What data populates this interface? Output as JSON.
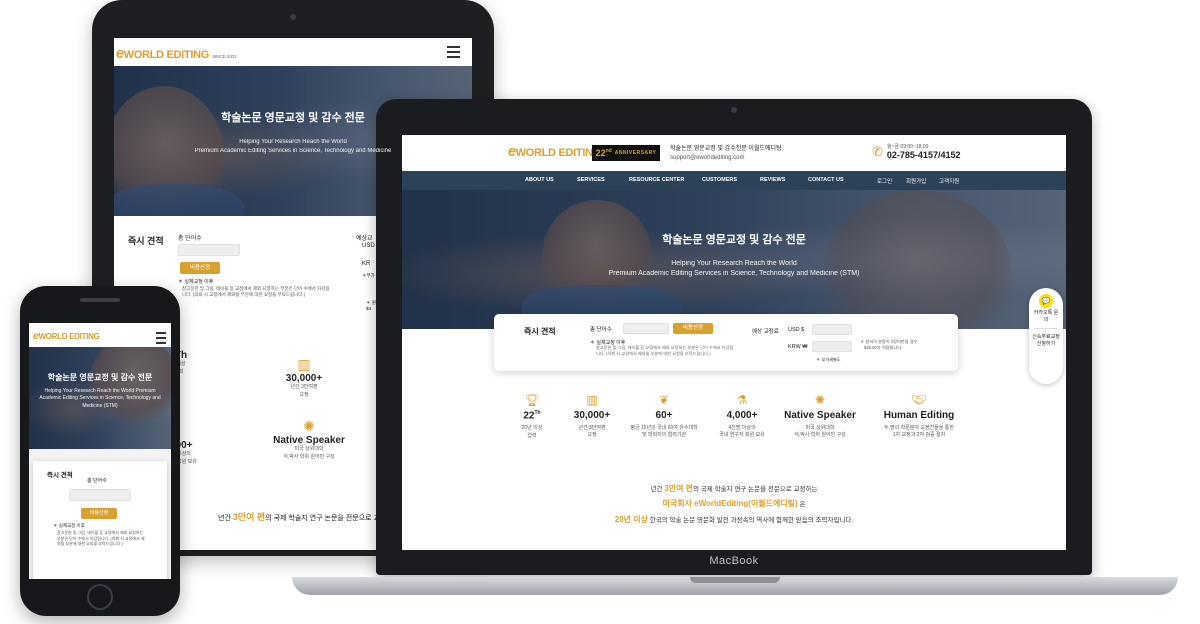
{
  "site": {
    "logo_main": "WORLD EDITING",
    "logo_e": "e",
    "logo_since": "SINCE 2001",
    "anniversary": "22",
    "anniversary_suffix": "nd",
    "anniversary_word": "ANNIVERSARY",
    "tagline": "학술논문 영문교정 및 감수전문 이월드에디팅",
    "email": "support@eworldediting.com",
    "hours": "월~금 09:00~18:00",
    "phone": "02-785-4157/4152"
  },
  "nav": {
    "items": [
      "ABOUT US",
      "SERVICES",
      "RESOURCE CENTER",
      "CUSTOMERS",
      "REVIEWS",
      "CONTACT US"
    ],
    "util": [
      "로그인",
      "회원가입",
      "고객지원"
    ]
  },
  "hero": {
    "title": "학술논문 영문교정 및 감수 전문",
    "line1": "Helping Your Research Reach the World",
    "line2": "Premium Academic Editing Services in Science, Technology and Medicine (STM)",
    "tablet_line2": "Premium Academic Editing Services in Science, Technology and Medicine",
    "phone_sub": "Helping Your Research Reach the World Premium Academic Editing Services in Science, Technology and Medicine (STM)"
  },
  "quote": {
    "title": "즉시 견적",
    "word_count_label": "총 단어수",
    "button": "비용산정",
    "price_label": "예상 교정료",
    "usd": "USD $",
    "krw": "KRW ₩",
    "vat": "＊ 부가세별도",
    "notice_title": "＊ 실제교정 이후",
    "notice_body": "참고문헌 및 그림, 테이블 등 교정에서 제외 요청하는 부분은 단어 수에서 차감됩니다. (의뢰 시 교정에서 제외될 부분에 대한 요청을 부탁드립니다.)",
    "side_note_1": "＊ 원서의 분량이 3장미만일 경우",
    "side_note_2": "$45.00가 적용됩니다.",
    "tablet_price_label": "예상교",
    "tablet_usd": "USD",
    "tablet_krw": "KR",
    "tablet_note": "＊부가",
    "tablet_side": "＊ 원",
    "tablet_side_2": "$4"
  },
  "float": {
    "kakao": "카카오톡 문의",
    "new": "신속무료교정 신청하기"
  },
  "stats": [
    {
      "icon": "trophy-icon",
      "value": "22",
      "sup": "Th",
      "desc1": "20년 이상",
      "desc2": "업력"
    },
    {
      "icon": "bar-chart-icon",
      "value": "30,000+",
      "sup": "",
      "desc1": "년간 3만여편",
      "desc2": "교정"
    },
    {
      "icon": "laurel-icon",
      "value": "60+",
      "sup": "",
      "desc1": "평균 15년의 국내 60여 유수대학",
      "desc2": "및 학회지의 협력기관"
    },
    {
      "icon": "flask-icon",
      "value": "4,000+",
      "sup": "",
      "desc1": "4천명 이상의",
      "desc2": "국내 연구자 회원 보유"
    },
    {
      "icon": "globe-icon",
      "value": "Native Speaker",
      "sup": "",
      "desc1": "미국 상위대학",
      "desc2": "석,박사 학위 원어민 구성"
    },
    {
      "icon": "handshake-icon",
      "value": "Human Editing",
      "sup": "",
      "desc1": "두 명의 학문분야 교정진들을 통한",
      "desc2": "1차 교정과 2차 검증 절차"
    }
  ],
  "tablet_stats": {
    "s1_val": "Th",
    "s1_d1": "이상",
    "s1_d2": "력",
    "s2_d1": "년간 3만여편",
    "s2_d2": "교정",
    "s3_val": "00+",
    "s3_d1": "이상의",
    "s3_d2": "자 회원 보유",
    "s4_d1": "미국 상위대학",
    "s4_d2": "석,박사 학위 원어민 구성",
    "s5_val": "H",
    "s5_d1": "두",
    "s6_d1": "협"
  },
  "intro": {
    "l1_pre": "년간",
    "l1_hl": "3만여 편",
    "l1_post": "의 국제 학술지 연구 논문을 전문으로 교정하는",
    "l2_hl": "미국회사 eWorldEditing(이월드에디팅)",
    "l2_post": "은",
    "l3_hl": "20년 이상",
    "l3_post": "한국의 학술 논문 영문화 발전 과정속의 역사에 함께한 믿음의 조력자입니다.",
    "tablet_pre": "년간",
    "tablet_hl": "3만여 편",
    "tablet_post": "의 국제 학술지 연구 논문을 전문으로 교정"
  },
  "phone_notice": "참고문헌 및 그림, 테이블 등 교정에서 제외 요청하는 부분은 단어 수에서 차감됩니다. (의뢰 시 교정에서 제외될 부분에 대한 요청을 부탁드립니다.)",
  "laptop_label": "MacBook",
  "colors": {
    "gold": "#d9a12f",
    "nav": "#2c4258",
    "device": "#1b1c1f"
  }
}
